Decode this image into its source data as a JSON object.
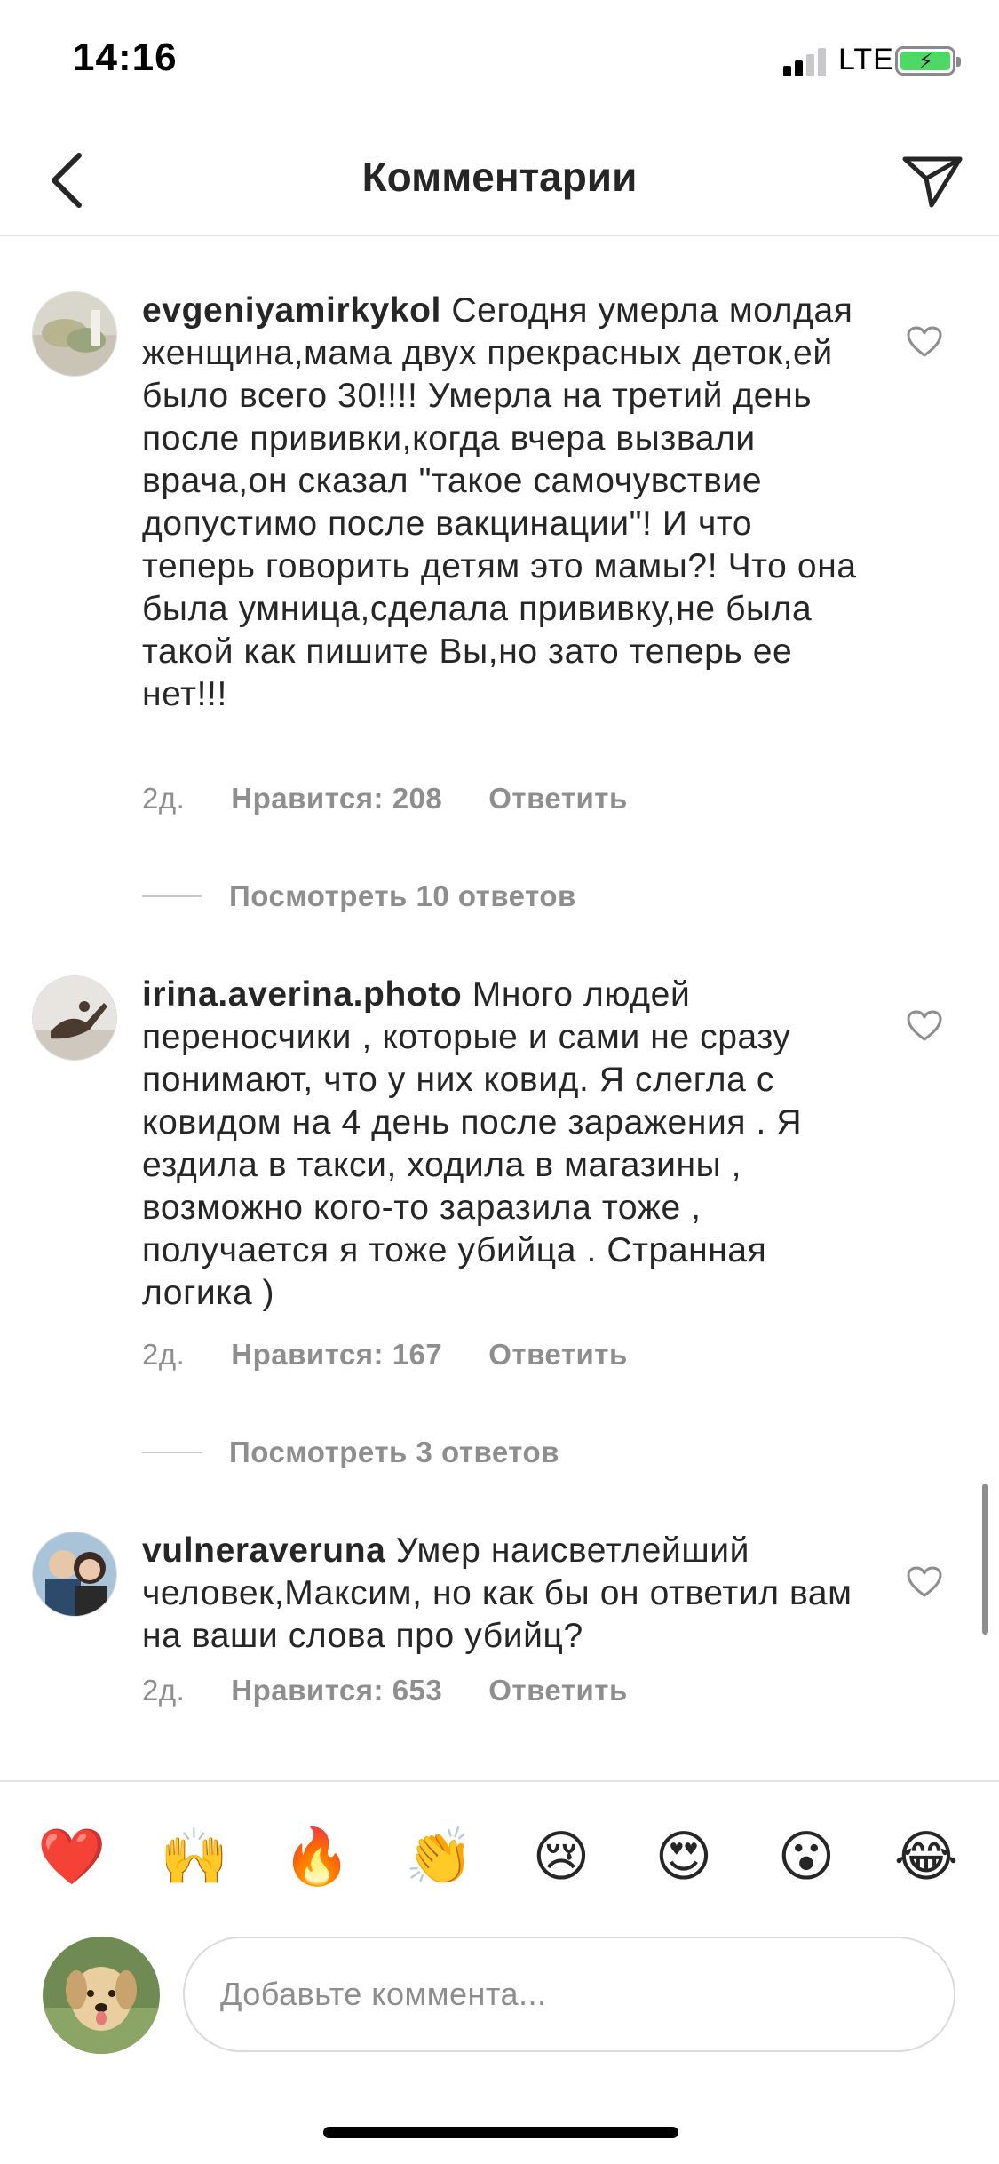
{
  "status": {
    "time": "14:16",
    "network": "LTE"
  },
  "header": {
    "title": "Комментарии"
  },
  "comments": [
    {
      "username": "evgeniyamirkykol",
      "text": " Сегодня умерла молдая женщина,мама двух прекрасных деток,ей было всего 30!!!! Умерла на третий день после прививки,когда вчера вызвали врача,он сказал \"такое самочувствие допустимо после вакцинации\"! И что теперь говорить детям это мамы?! Что она была умница,сделала прививку,не была такой как пишите Вы,но зато теперь ее нет!!!",
      "time": "2д.",
      "likes": "Нравится: 208",
      "reply": "Ответить",
      "view_replies": "Посмотреть 10 ответов"
    },
    {
      "username": "irina.averina.photo",
      "text": " Много людей переносчики , которые и сами не сразу понимают, что у них ковид.  Я слегла с ковидом на 4 день после заражения . Я ездила в такси, ходила в магазины , возможно кого-то заразила тоже , получается я тоже убийца . Странная логика )",
      "time": "2д.",
      "likes": "Нравится: 167",
      "reply": "Ответить",
      "view_replies": "Посмотреть 3 ответов"
    },
    {
      "username": "vulneraveruna",
      "text": " Умер наисветлейший человек,Максим, но как бы он ответил вам на ваши слова про убийц?",
      "time": "2д.",
      "likes": "Нравится: 653",
      "reply": "Ответить"
    }
  ],
  "emoji_bar": [
    "❤️",
    "🙌",
    "🔥",
    "👏",
    "😢",
    "😍",
    "😮",
    "😂"
  ],
  "input": {
    "placeholder": "Добавьте коммента..."
  },
  "icons": {
    "back": "chevron-left-icon",
    "send": "paper-plane-icon",
    "like": "heart-outline-icon"
  },
  "colors": {
    "text": "#262626",
    "secondary": "#8e8e8e",
    "divider": "#e3e3e3",
    "battery": "#4cd964"
  }
}
